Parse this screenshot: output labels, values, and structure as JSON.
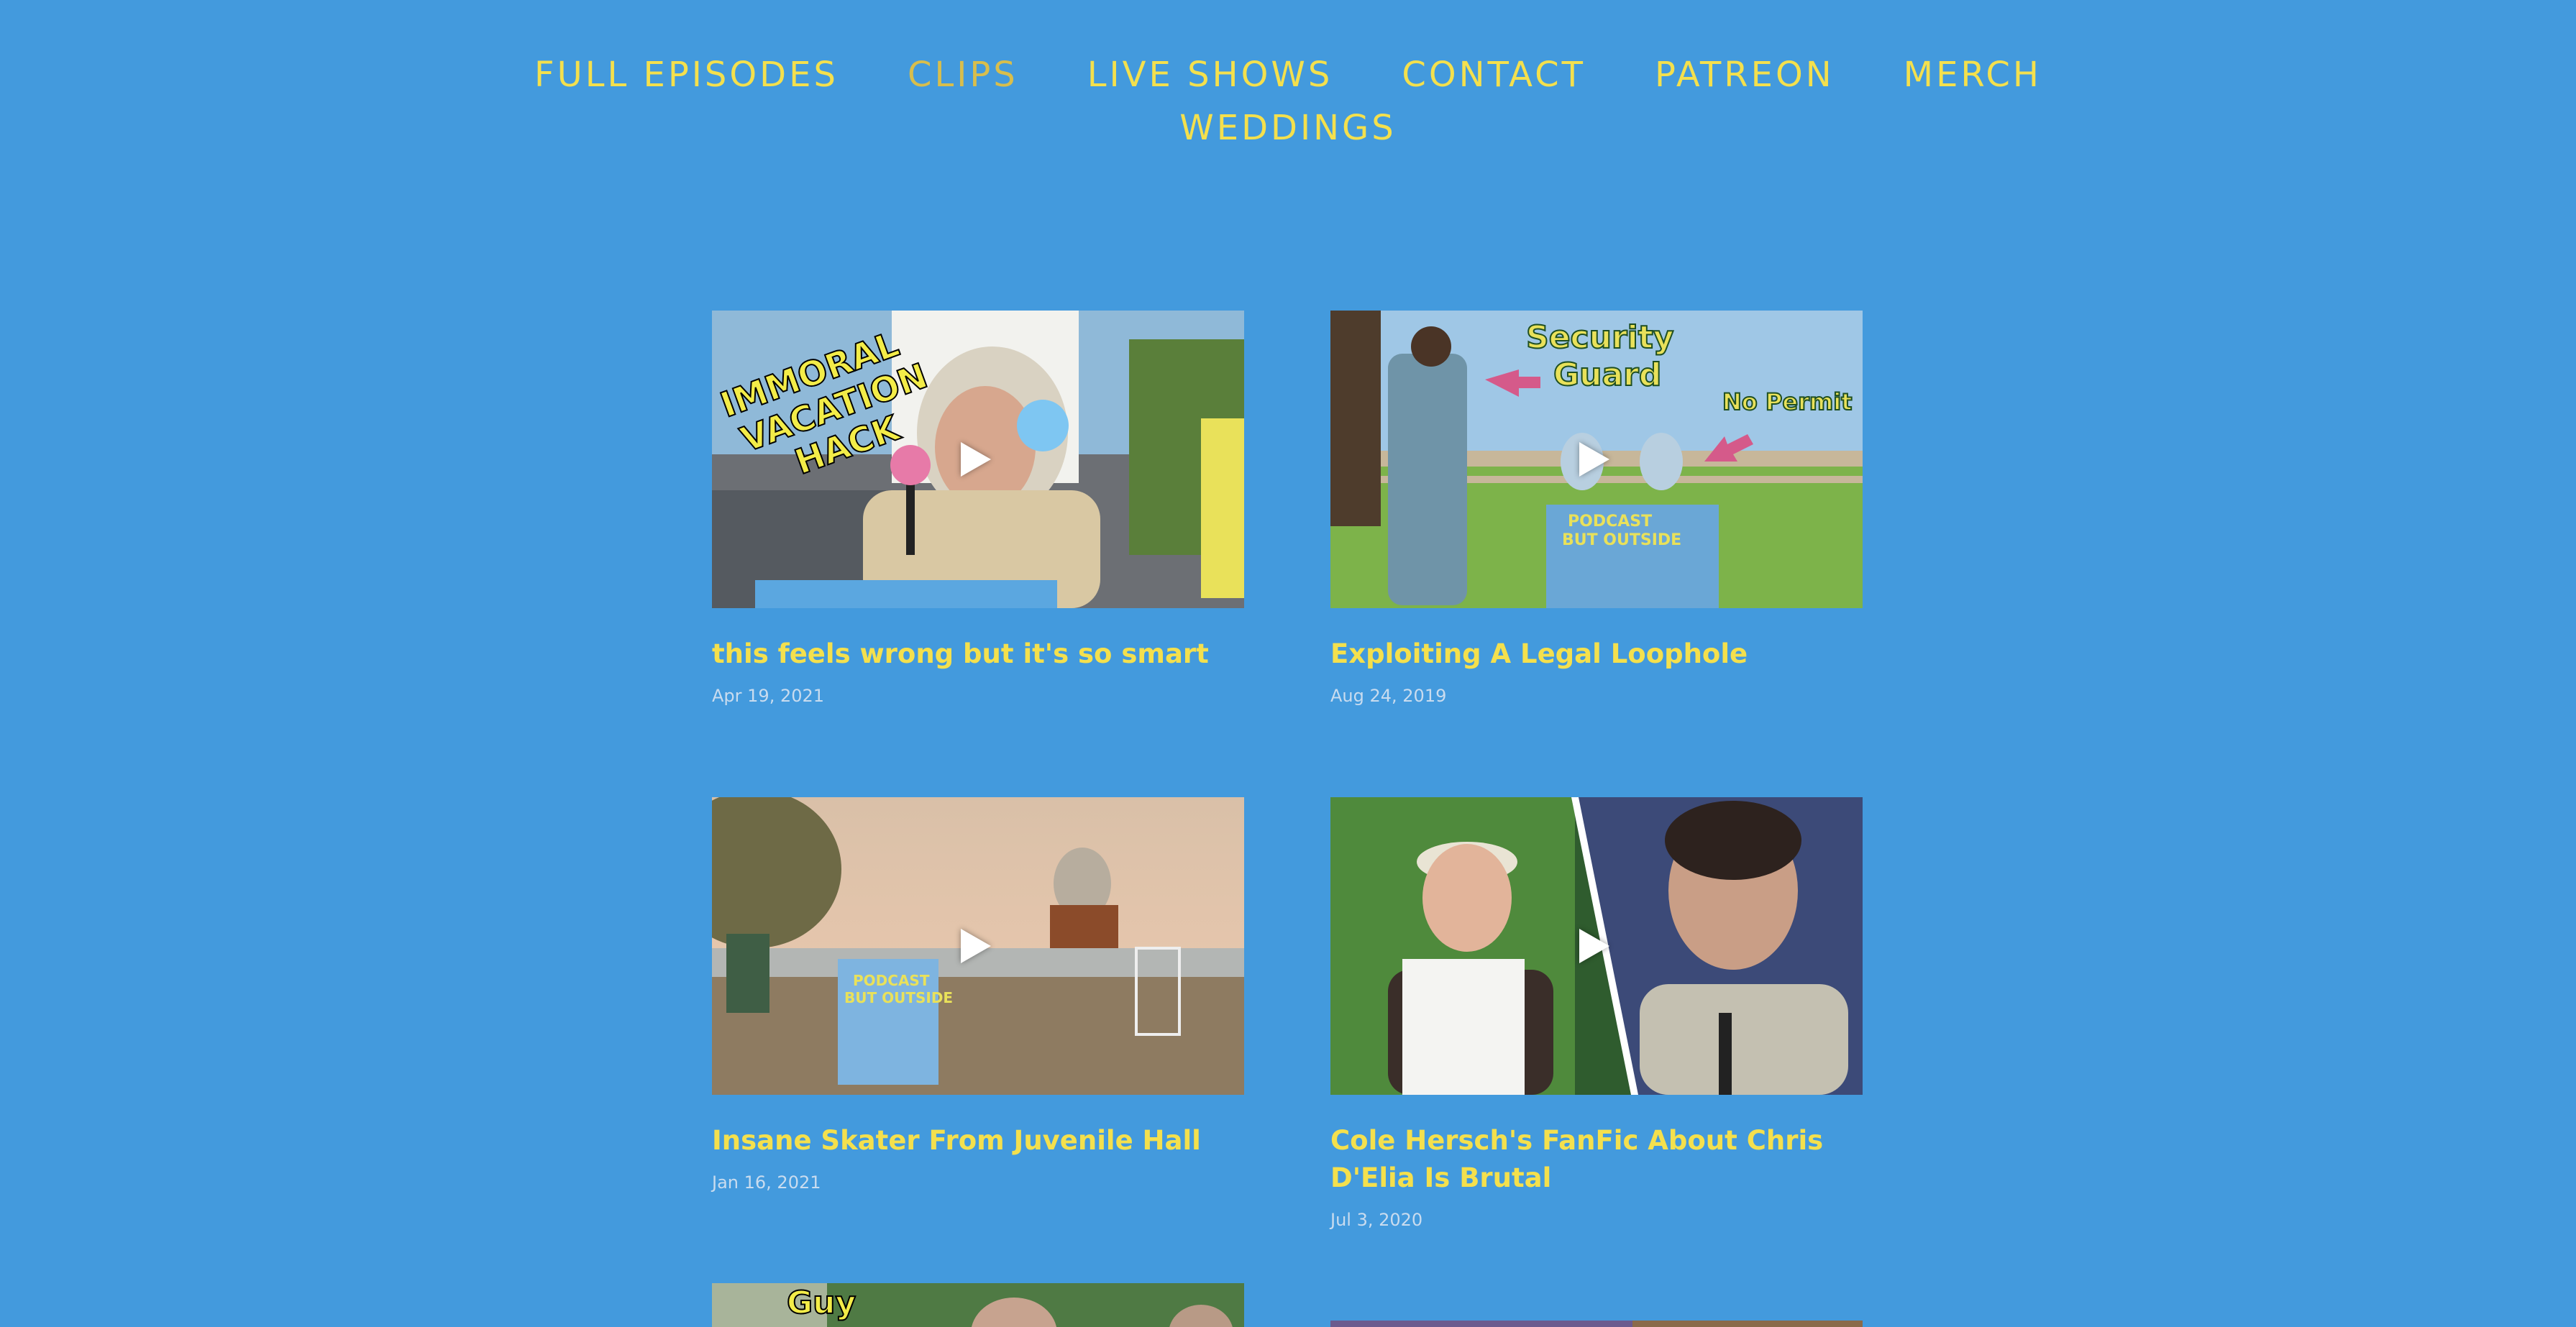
{
  "nav": {
    "items": [
      {
        "label": "FULL EPISODES",
        "active": false
      },
      {
        "label": "CLIPS",
        "active": true
      },
      {
        "label": "LIVE SHOWS",
        "active": false
      },
      {
        "label": "CONTACT",
        "active": false
      },
      {
        "label": "PATREON",
        "active": false
      },
      {
        "label": "MERCH",
        "active": false
      },
      {
        "label": "WEDDINGS",
        "active": false
      }
    ]
  },
  "colors": {
    "background": "#439ADD",
    "accent_text": "#F4E04D",
    "active_nav": "#D8BE4C",
    "date_text": "#C9DCEF"
  },
  "videos": [
    {
      "title": "this feels wrong but it's so smart",
      "date": "Apr 19, 2021",
      "thumbnail_text": [
        "IMMORAL",
        "VACATION",
        "HACK"
      ],
      "play_icon": "play-icon"
    },
    {
      "title": "Exploiting A Legal Loophole",
      "date": "Aug 24, 2019",
      "thumbnail_text": [
        "Security",
        "Guard",
        "No Permit",
        "PODCAST",
        "BUT OUTSIDE"
      ],
      "play_icon": "play-icon"
    },
    {
      "title": "Insane Skater From Juvenile Hall",
      "date": "Jan 16, 2021",
      "thumbnail_text": [
        "PODCAST",
        "BUT OUTSIDE"
      ],
      "play_icon": "play-icon"
    },
    {
      "title": "Cole Hersch's FanFic About Chris D'Elia Is Brutal",
      "date": "Jul 3, 2020",
      "play_icon": "play-icon"
    },
    {
      "thumbnail_text": [
        "Guy"
      ]
    },
    {}
  ]
}
